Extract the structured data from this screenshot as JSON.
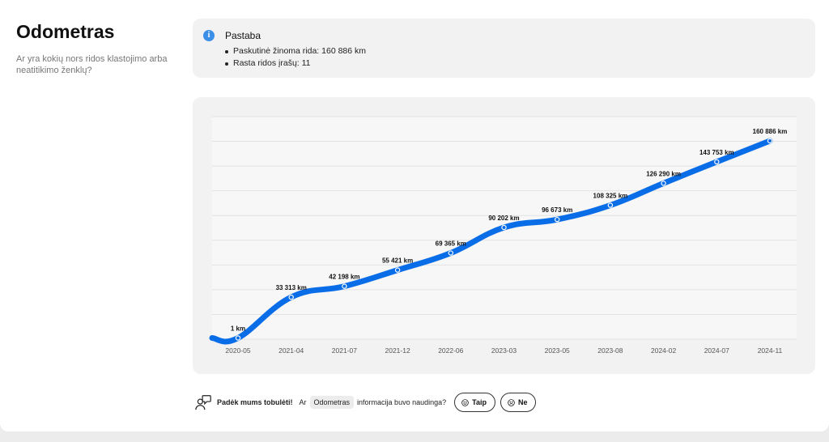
{
  "page": {
    "title": "Odometras",
    "description": "Ar yra kokių nors ridos klastojimo arba neatitikimo ženklų?"
  },
  "note": {
    "icon": "info-icon",
    "title": "Pastaba",
    "items": [
      "Paskutinė žinoma rida: 160 886 km",
      "Rasta ridos įrašų: 11"
    ]
  },
  "chart_data": {
    "type": "line",
    "categories": [
      "2020-05",
      "2021-04",
      "2021-07",
      "2021-12",
      "2022-06",
      "2023-03",
      "2023-05",
      "2023-08",
      "2024-02",
      "2024-07",
      "2024-11"
    ],
    "series": [
      {
        "values": [
          1,
          33313,
          42198,
          55421,
          69365,
          90202,
          96673,
          108325,
          126290,
          143753,
          160886
        ],
        "point_labels": [
          "1 km",
          "33 313 km",
          "42 198 km",
          "55 421 km",
          "69 365 km",
          "90 202 km",
          "96 673 km",
          "108 325 km",
          "126 290 km",
          "143 753 km",
          "160 886 km"
        ]
      }
    ],
    "ylim": [
      0,
      180000
    ],
    "grid": true,
    "line_color": "#0a6de8"
  },
  "feedback": {
    "icon": "chat-person-icon",
    "prompt_bold": "Padėk mums tobulėti!",
    "prompt_pre": "Ar",
    "tag": "Odometras",
    "prompt_post": "informacija buvo naudinga?",
    "yes_label": "Taip",
    "no_label": "Ne"
  }
}
